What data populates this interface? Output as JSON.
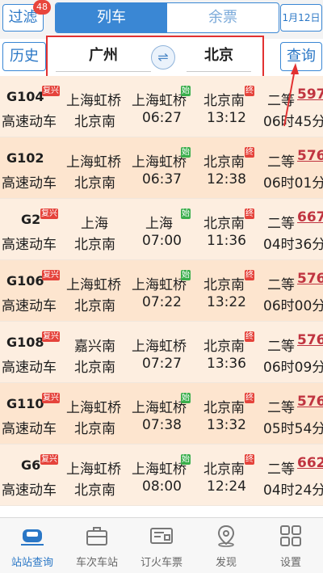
{
  "topbar": {
    "filter_label": "过滤",
    "filter_badge": "48",
    "tabs": [
      "列车",
      "余票"
    ],
    "date_label": "1月12日"
  },
  "search": {
    "history_label": "历史",
    "from_city": "广州",
    "to_city": "北京",
    "query_label": "查询"
  },
  "trains": [
    {
      "code": "G104",
      "tag": "复兴",
      "type": "高速动车",
      "from_station": "上海虹桥",
      "to_station": "北京南",
      "depart_station": "上海虹桥",
      "depart_tag": "始",
      "depart_time": "06:27",
      "arrive_station": "北京南",
      "arrive_tag": "终",
      "arrive_time": "13:12",
      "seat_class": "二等",
      "price": "597",
      "duration": "06时45分"
    },
    {
      "code": "G102",
      "tag": "",
      "type": "高速动车",
      "from_station": "上海虹桥",
      "to_station": "北京南",
      "depart_station": "上海虹桥",
      "depart_tag": "始",
      "depart_time": "06:37",
      "arrive_station": "北京南",
      "arrive_tag": "终",
      "arrive_time": "12:38",
      "seat_class": "二等",
      "price": "576",
      "duration": "06时01分"
    },
    {
      "code": "G2",
      "tag": "复兴",
      "type": "高速动车",
      "from_station": "上海",
      "to_station": "北京南",
      "depart_station": "上海",
      "depart_tag": "始",
      "depart_time": "07:00",
      "arrive_station": "北京南",
      "arrive_tag": "终",
      "arrive_time": "11:36",
      "seat_class": "二等",
      "price": "667",
      "duration": "04时36分"
    },
    {
      "code": "G106",
      "tag": "复兴",
      "type": "高速动车",
      "from_station": "上海虹桥",
      "to_station": "北京南",
      "depart_station": "上海虹桥",
      "depart_tag": "始",
      "depart_time": "07:22",
      "arrive_station": "北京南",
      "arrive_tag": "终",
      "arrive_time": "13:22",
      "seat_class": "二等",
      "price": "576",
      "duration": "06时00分"
    },
    {
      "code": "G108",
      "tag": "复兴",
      "type": "高速动车",
      "from_station": "嘉兴南",
      "to_station": "北京南",
      "depart_station": "上海虹桥",
      "depart_tag": "",
      "depart_time": "07:27",
      "arrive_station": "北京南",
      "arrive_tag": "终",
      "arrive_time": "13:36",
      "seat_class": "二等",
      "price": "576",
      "duration": "06时09分"
    },
    {
      "code": "G110",
      "tag": "复兴",
      "type": "高速动车",
      "from_station": "上海虹桥",
      "to_station": "北京南",
      "depart_station": "上海虹桥",
      "depart_tag": "始",
      "depart_time": "07:38",
      "arrive_station": "北京南",
      "arrive_tag": "终",
      "arrive_time": "13:32",
      "seat_class": "二等",
      "price": "576",
      "duration": "05时54分"
    },
    {
      "code": "G6",
      "tag": "复兴",
      "type": "高速动车",
      "from_station": "上海虹桥",
      "to_station": "北京南",
      "depart_station": "上海虹桥",
      "depart_tag": "始",
      "depart_time": "08:00",
      "arrive_station": "北京南",
      "arrive_tag": "终",
      "arrive_time": "12:24",
      "seat_class": "二等",
      "price": "662",
      "duration": "04时24分"
    }
  ],
  "footer": {
    "items": [
      {
        "label": "站站查询",
        "icon": "train-icon"
      },
      {
        "label": "车次车站",
        "icon": "briefcase-icon"
      },
      {
        "label": "订火车票",
        "icon": "ticket-icon"
      },
      {
        "label": "发现",
        "icon": "location-icon"
      },
      {
        "label": "设置",
        "icon": "grid-icon"
      }
    ]
  },
  "colors": {
    "accent": "#3a87d4",
    "row_light": "#fdeee0",
    "row_dark": "#fde5cf",
    "price": "#c03440",
    "highlight_box": "#e23131"
  }
}
